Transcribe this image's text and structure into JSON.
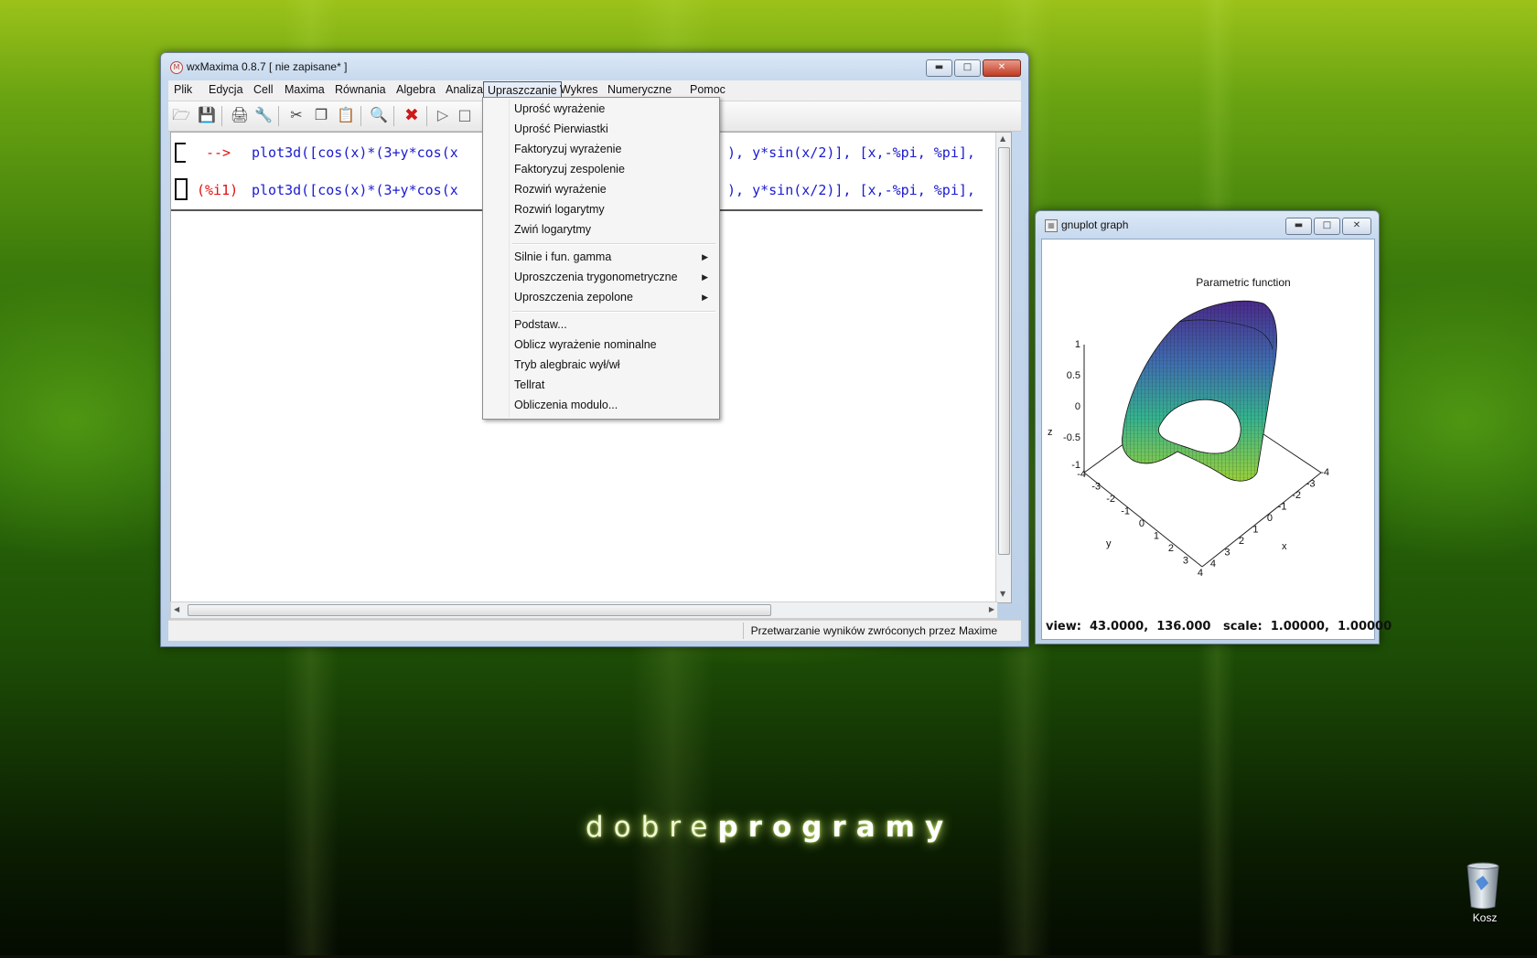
{
  "wxmaxima": {
    "title": "wxMaxima 0.8.7 [ nie zapisane* ]",
    "menu": [
      "Plik",
      "Edycja",
      "Cell",
      "Maxima",
      "Równania",
      "Algebra",
      "Analiza",
      "Upraszczanie",
      "Wykres",
      "Numeryczne",
      "Pomoc"
    ],
    "active_menu": "Upraszczanie",
    "cells": [
      {
        "prompt": "-->",
        "code": "plot3d([cos(x)*(3+y*cos(x",
        "code_tail": "), y*sin(x/2)], [x,-%pi, %pi],"
      },
      {
        "prompt": "(%i1)",
        "code": "plot3d([cos(x)*(3+y*cos(x",
        "code_tail": "), y*sin(x/2)], [x,-%pi, %pi],"
      }
    ],
    "status": "Przetwarzanie wyników zwróconych przez Maxime"
  },
  "dropdown": {
    "groups": [
      [
        "Uprość wyrażenie",
        "Uprość Pierwiastki",
        "Faktoryzuj wyrażenie",
        "Faktoryzuj zespolenie",
        "Rozwiń wyrażenie",
        "Rozwiń logarytmy",
        "Zwiń logarytmy"
      ],
      [
        "Silnie i fun. gamma",
        "Uproszczenia trygonometryczne",
        "Uproszczenia zepolone"
      ],
      [
        "Podstaw...",
        "Oblicz wyrażenie nominalne",
        "Tryb alegbraic wył/wł",
        "Tellrat",
        "Obliczenia modulo..."
      ]
    ]
  },
  "gnuplot": {
    "title": "gnuplot graph",
    "chart_title": "Parametric function",
    "z_label": "z",
    "z_ticks": [
      "1",
      "0.5",
      "0",
      "-0.5",
      "-1"
    ],
    "y_label": "y",
    "y_ticks": [
      "-4",
      "-3",
      "-2",
      "-1",
      "0",
      "1",
      "2",
      "3",
      "4"
    ],
    "x_label": "x",
    "x_ticks": [
      "4",
      "3",
      "2",
      "1",
      "0",
      "-1",
      "-2",
      "-3",
      "-4"
    ],
    "view": "view:  43.0000,  136.000   scale:  1.00000,  1.00000"
  },
  "desktop": {
    "brand_light": "dobre",
    "brand_bold": "programy",
    "trash_label": "Kosz"
  }
}
